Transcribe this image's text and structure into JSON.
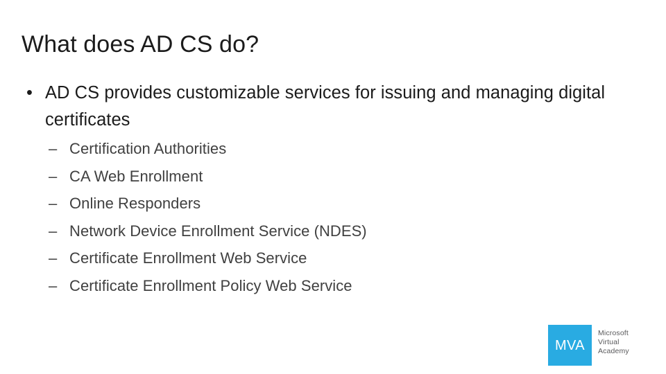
{
  "slide": {
    "title": "What does AD CS do?",
    "background_color": "#ffffff",
    "title_color": "#1b1b1b"
  },
  "content": {
    "main_bullet": {
      "marker": "•",
      "text": "AD CS provides customizable services for issuing and managing digital certificates",
      "color": "#1b1b1b"
    },
    "sub_bullets": {
      "marker": "–",
      "color": "#404040",
      "items": [
        {
          "text": "Certification Authorities"
        },
        {
          "text": "CA Web Enrollment"
        },
        {
          "text": "Online Responders"
        },
        {
          "text": "Network Device Enrollment Service (NDES)"
        },
        {
          "text": "Certificate Enrollment Web Service"
        },
        {
          "text": "Certificate Enrollment Policy Web Service"
        }
      ]
    }
  },
  "logo": {
    "mark_text": "MVA",
    "mark_background_color": "#29abe2",
    "mark_text_color": "#ffffff",
    "wordmark_color": "#59595b",
    "wordmark_line1": "Microsoft",
    "wordmark_line2": "Virtual",
    "wordmark_line3": "Academy"
  }
}
